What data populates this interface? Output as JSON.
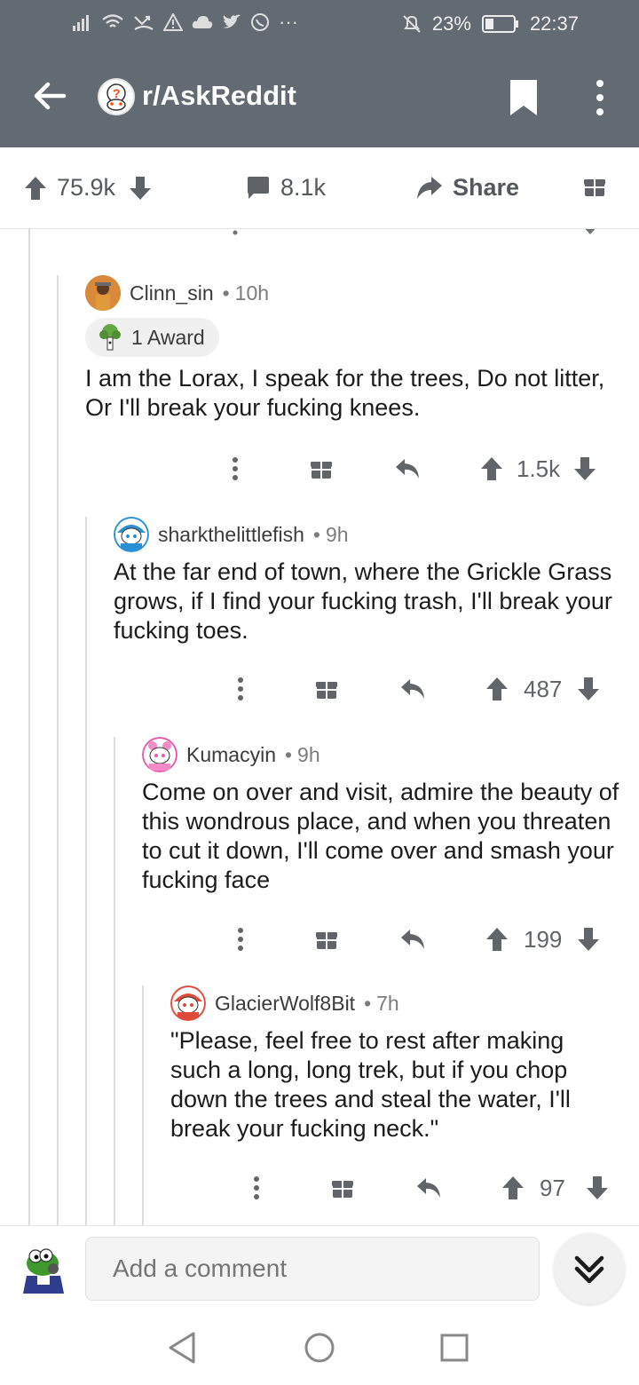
{
  "status_bar": {
    "battery": "23%",
    "time": "22:37",
    "more": "···"
  },
  "header": {
    "subreddit": "r/AskReddit"
  },
  "post_bar": {
    "upvotes": "75.9k",
    "comments": "8.1k",
    "share_label": "Share"
  },
  "comments": [
    {
      "author": "Clinn_sin",
      "separator": "•",
      "age": "10h",
      "award_label": "1 Award",
      "body": "I am the Lorax, I speak for the trees, Do not litter, Or I'll break your fucking knees.",
      "score": "1.5k"
    },
    {
      "author": "sharkthelittlefish",
      "separator": "•",
      "age": "9h",
      "body": "At the far end of town, where the Grickle Grass grows, if I find your fucking trash, I'll break your fucking toes.",
      "score": "487"
    },
    {
      "author": "Kumacyin",
      "separator": "•",
      "age": "9h",
      "body": "Come on over and visit, admire the beauty of this wondrous place, and when you threaten to cut it down, I'll come over and smash your fucking face",
      "score": "199"
    },
    {
      "author": "GlacierWolf8Bit",
      "separator": "•",
      "age": "7h",
      "body": "\"Please, feel free to rest after making such a long, long trek, but if you chop down the trees and steal the water, I'll break your fucking neck.\"",
      "score": "97"
    }
  ],
  "composer": {
    "placeholder": "Add a comment"
  },
  "icons": {
    "upvote": "arrow-up-icon",
    "downvote": "arrow-down-icon",
    "reply": "reply-icon",
    "gift": "gift-icon",
    "more": "more-vertical-icon"
  },
  "colors": {
    "header_bg": "#646a72",
    "text": "#1c1c1c",
    "muted": "#7c7c7c"
  }
}
